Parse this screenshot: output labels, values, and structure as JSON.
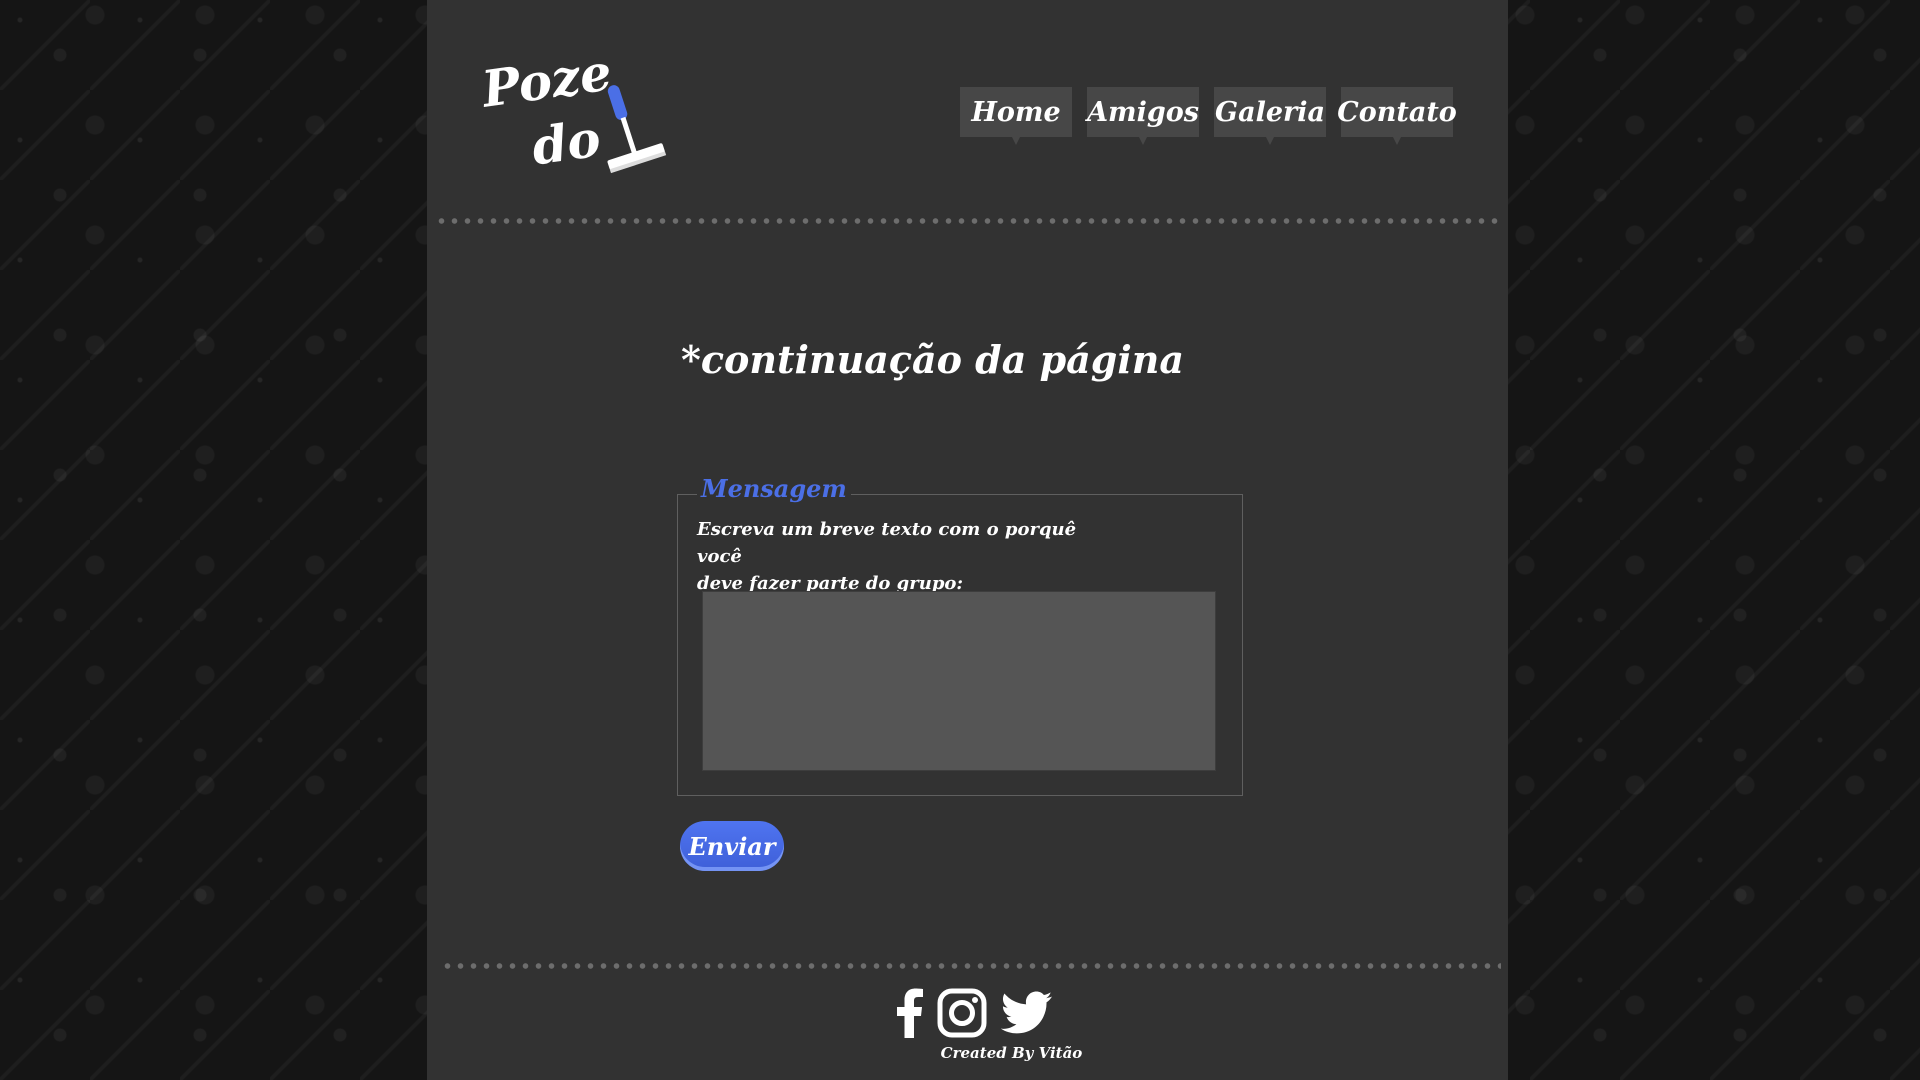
{
  "logo": {
    "line1": "Poze",
    "line2": "do",
    "squeegee_icon": "squeegee-icon",
    "accent_color": "#4b6fe6"
  },
  "nav": {
    "items": [
      {
        "label": "Home"
      },
      {
        "label": "Amigos"
      },
      {
        "label": "Galeria"
      },
      {
        "label": "Contato"
      }
    ]
  },
  "main": {
    "title": "*continuação da página",
    "form": {
      "legend": "Mensagem",
      "instruction_line1": "Escreva um breve texto com o porquê você",
      "instruction_line2": "deve fazer parte do grupo:",
      "message_value": "",
      "submit_label": "Enviar"
    }
  },
  "footer": {
    "social_icons": [
      "facebook-icon",
      "instagram-icon",
      "twitter-icon"
    ],
    "credit": "Created By Vitão"
  },
  "colors": {
    "page_background": "#151515",
    "container": "#323232",
    "nav_item": "#474747",
    "textarea": "#555555",
    "button": "#4b6fe6"
  }
}
